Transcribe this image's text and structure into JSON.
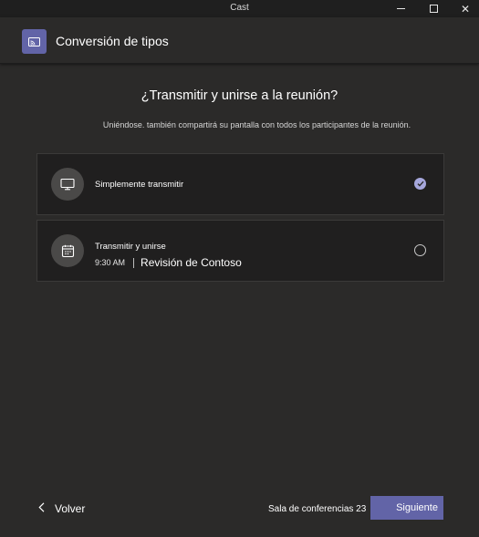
{
  "window": {
    "title": "Cast",
    "minimize_icon": "minimize-icon",
    "maximize_icon": "maximize-icon",
    "close_icon": "close-icon",
    "close_glyph": "✕"
  },
  "header": {
    "icon": "cast-icon",
    "title": "Conversión de tipos"
  },
  "main": {
    "title": "¿Transmitir y unirse a la reunión?",
    "subtitle": "Uniéndose. también compartirá su pantalla con todos los participantes de la reunión."
  },
  "options": [
    {
      "icon": "monitor-icon",
      "label": "Simplemente transmitir",
      "selected": true
    },
    {
      "icon": "calendar-icon",
      "label": "Transmitir y unirse",
      "time": "9:30 AM",
      "meeting": "Revisión de Contoso",
      "selected": false
    }
  ],
  "footer": {
    "back_label": "Volver",
    "back_icon": "chevron-left-icon",
    "room_label": "Sala de conferencias 23",
    "next_label": "Siguiente"
  },
  "colors": {
    "accent": "#6264a7",
    "check": "#a6a7dc",
    "background": "#2b2a29",
    "card": "#201f1f"
  }
}
